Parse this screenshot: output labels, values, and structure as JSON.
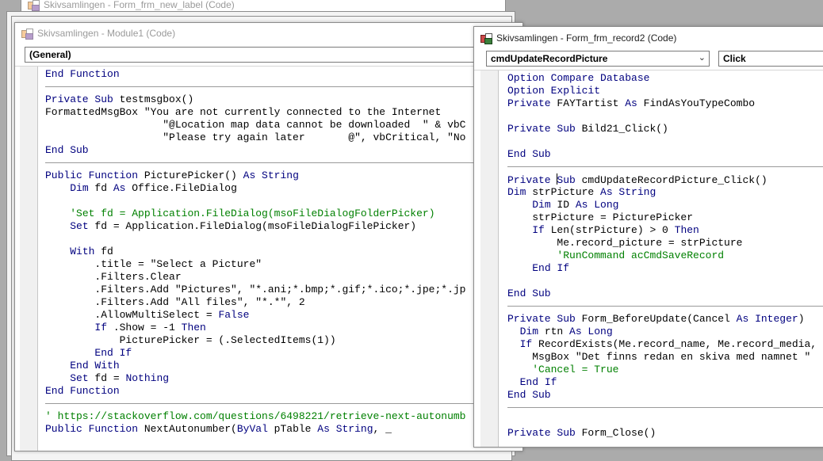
{
  "background_window": {
    "title": "Skivsamlingen - Form_frm_new_label (Code)"
  },
  "module_window": {
    "title": "Skivsamlingen - Module1 (Code)",
    "object_combo": "(General)",
    "lines": [
      {
        "seg": [
          {
            "t": "End Function",
            "c": "kw"
          }
        ]
      },
      {
        "sep": true
      },
      {
        "seg": [
          {
            "t": "Private Sub",
            "c": "kw"
          },
          {
            "t": " testmsgbox()"
          }
        ]
      },
      {
        "seg": [
          {
            "t": "FormattedMsgBox \"You are not currently connected to the Internet "
          }
        ]
      },
      {
        "seg": [
          {
            "t": "                   \"@Location map data cannot be downloaded  \" & vbC"
          }
        ]
      },
      {
        "seg": [
          {
            "t": "                   \"Please try again later       @\", vbCritical, \"No"
          }
        ]
      },
      {
        "seg": [
          {
            "t": "End Sub",
            "c": "kw"
          }
        ]
      },
      {
        "sep": true
      },
      {
        "seg": [
          {
            "t": "Public Function",
            "c": "kw"
          },
          {
            "t": " PicturePicker() "
          },
          {
            "t": "As String",
            "c": "kw"
          }
        ]
      },
      {
        "seg": [
          {
            "t": "    "
          },
          {
            "t": "Dim",
            "c": "kw"
          },
          {
            "t": " fd "
          },
          {
            "t": "As",
            "c": "kw"
          },
          {
            "t": " Office.FileDialog"
          }
        ]
      },
      {
        "seg": [
          {
            "t": ""
          }
        ]
      },
      {
        "seg": [
          {
            "t": "    "
          },
          {
            "t": "'Set fd = Application.FileDialog(msoFileDialogFolderPicker)",
            "c": "cm"
          }
        ]
      },
      {
        "seg": [
          {
            "t": "    "
          },
          {
            "t": "Set",
            "c": "kw"
          },
          {
            "t": " fd = Application.FileDialog(msoFileDialogFilePicker)"
          }
        ]
      },
      {
        "seg": [
          {
            "t": ""
          }
        ]
      },
      {
        "seg": [
          {
            "t": "    "
          },
          {
            "t": "With",
            "c": "kw"
          },
          {
            "t": " fd"
          }
        ]
      },
      {
        "seg": [
          {
            "t": "        .title = \"Select a Picture\""
          }
        ]
      },
      {
        "seg": [
          {
            "t": "        .Filters.Clear"
          }
        ]
      },
      {
        "seg": [
          {
            "t": "        .Filters.Add \"Pictures\", \"*.ani;*.bmp;*.gif;*.ico;*.jpe;*.jp"
          }
        ]
      },
      {
        "seg": [
          {
            "t": "        .Filters.Add \"All files\", \"*.*\", 2"
          }
        ]
      },
      {
        "seg": [
          {
            "t": "        .AllowMultiSelect = "
          },
          {
            "t": "False",
            "c": "kw"
          }
        ]
      },
      {
        "seg": [
          {
            "t": "        "
          },
          {
            "t": "If",
            "c": "kw"
          },
          {
            "t": " .Show = -1 "
          },
          {
            "t": "Then",
            "c": "kw"
          }
        ]
      },
      {
        "seg": [
          {
            "t": "            PicturePicker = (.SelectedItems(1))"
          }
        ]
      },
      {
        "seg": [
          {
            "t": "        "
          },
          {
            "t": "End If",
            "c": "kw"
          }
        ]
      },
      {
        "seg": [
          {
            "t": "    "
          },
          {
            "t": "End With",
            "c": "kw"
          }
        ]
      },
      {
        "seg": [
          {
            "t": "    "
          },
          {
            "t": "Set",
            "c": "kw"
          },
          {
            "t": " fd = "
          },
          {
            "t": "Nothing",
            "c": "kw"
          }
        ]
      },
      {
        "seg": [
          {
            "t": "End Function",
            "c": "kw"
          }
        ]
      },
      {
        "sep": true
      },
      {
        "seg": [
          {
            "t": "' https://stackoverflow.com/questions/6498221/retrieve-next-autonumb",
            "c": "cm"
          }
        ]
      },
      {
        "seg": [
          {
            "t": "Public Function",
            "c": "kw"
          },
          {
            "t": " NextAutonumber("
          },
          {
            "t": "ByVal",
            "c": "kw"
          },
          {
            "t": " pTable "
          },
          {
            "t": "As String",
            "c": "kw"
          },
          {
            "t": ", _"
          }
        ]
      }
    ]
  },
  "form_window": {
    "title": "Skivsamlingen - Form_frm_record2 (Code)",
    "object_combo": "cmdUpdateRecordPicture",
    "procedure_combo": "Click",
    "lines": [
      {
        "seg": [
          {
            "t": "Option Compare Database",
            "c": "kw"
          }
        ]
      },
      {
        "seg": [
          {
            "t": "Option Explicit",
            "c": "kw"
          }
        ]
      },
      {
        "seg": [
          {
            "t": "Private",
            "c": "kw"
          },
          {
            "t": " FAYTartist "
          },
          {
            "t": "As",
            "c": "kw"
          },
          {
            "t": " FindAsYouTypeCombo"
          }
        ]
      },
      {
        "seg": [
          {
            "t": ""
          }
        ]
      },
      {
        "seg": [
          {
            "t": "Private Sub",
            "c": "kw"
          },
          {
            "t": " Bild21_Click()"
          }
        ]
      },
      {
        "seg": [
          {
            "t": ""
          }
        ]
      },
      {
        "seg": [
          {
            "t": "End Sub",
            "c": "kw"
          }
        ]
      },
      {
        "sep": true
      },
      {
        "caret": true,
        "seg": [
          {
            "t": "Private ",
            "c": "kw"
          },
          {
            "t": "CARET"
          },
          {
            "t": "Sub",
            "c": "kw"
          },
          {
            "t": " cmdUpdateRecordPicture_Click()"
          }
        ]
      },
      {
        "seg": [
          {
            "t": "Dim",
            "c": "kw"
          },
          {
            "t": " strPicture "
          },
          {
            "t": "As String",
            "c": "kw"
          }
        ]
      },
      {
        "seg": [
          {
            "t": "    "
          },
          {
            "t": "Dim",
            "c": "kw"
          },
          {
            "t": " ID "
          },
          {
            "t": "As Long",
            "c": "kw"
          }
        ]
      },
      {
        "seg": [
          {
            "t": "    strPicture = PicturePicker"
          }
        ]
      },
      {
        "seg": [
          {
            "t": "    "
          },
          {
            "t": "If",
            "c": "kw"
          },
          {
            "t": " Len(strPicture) > 0 "
          },
          {
            "t": "Then",
            "c": "kw"
          }
        ]
      },
      {
        "seg": [
          {
            "t": "        Me.record_picture = strPicture"
          }
        ]
      },
      {
        "seg": [
          {
            "t": "        "
          },
          {
            "t": "'RunCommand acCmdSaveRecord",
            "c": "cm"
          }
        ]
      },
      {
        "seg": [
          {
            "t": "    "
          },
          {
            "t": "End If",
            "c": "kw"
          }
        ]
      },
      {
        "seg": [
          {
            "t": ""
          }
        ]
      },
      {
        "seg": [
          {
            "t": "End Sub",
            "c": "kw"
          }
        ]
      },
      {
        "sep": true
      },
      {
        "seg": [
          {
            "t": "Private Sub",
            "c": "kw"
          },
          {
            "t": " Form_BeforeUpdate(Cancel "
          },
          {
            "t": "As Integer",
            "c": "kw"
          },
          {
            "t": ")"
          }
        ]
      },
      {
        "seg": [
          {
            "t": "  "
          },
          {
            "t": "Dim",
            "c": "kw"
          },
          {
            "t": " rtn "
          },
          {
            "t": "As Long",
            "c": "kw"
          }
        ]
      },
      {
        "seg": [
          {
            "t": "  "
          },
          {
            "t": "If",
            "c": "kw"
          },
          {
            "t": " RecordExists(Me.record_name, Me.record_media,"
          }
        ]
      },
      {
        "seg": [
          {
            "t": "    MsgBox \"Det finns redan en skiva med namnet \""
          }
        ]
      },
      {
        "seg": [
          {
            "t": "    "
          },
          {
            "t": "'Cancel = True",
            "c": "cm"
          }
        ]
      },
      {
        "seg": [
          {
            "t": "  "
          },
          {
            "t": "End If",
            "c": "kw"
          }
        ]
      },
      {
        "seg": [
          {
            "t": "End Sub",
            "c": "kw"
          }
        ]
      },
      {
        "sep": true
      },
      {
        "seg": [
          {
            "t": ""
          }
        ]
      },
      {
        "seg": [
          {
            "t": "Private Sub",
            "c": "kw"
          },
          {
            "t": " Form_Close()"
          }
        ]
      }
    ]
  }
}
